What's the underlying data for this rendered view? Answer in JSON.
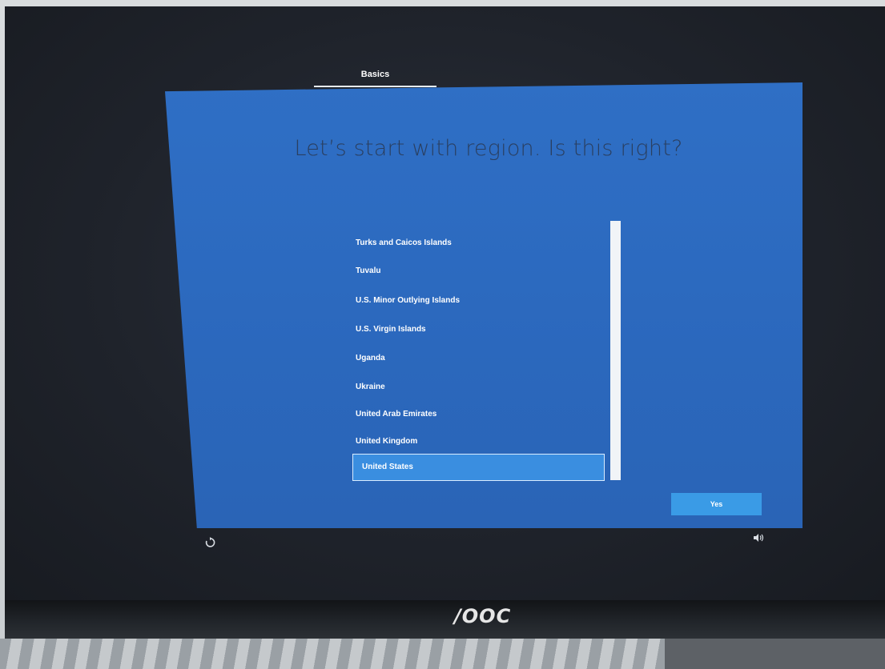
{
  "header": {
    "tab_label": "Basics"
  },
  "main": {
    "title": "Let’s start with region. Is this right?",
    "regions": [
      {
        "label": "Turks and Caicos Islands",
        "selected": false
      },
      {
        "label": "Tuvalu",
        "selected": false
      },
      {
        "label": "U.S. Minor Outlying Islands",
        "selected": false
      },
      {
        "label": "U.S. Virgin Islands",
        "selected": false
      },
      {
        "label": "Uganda",
        "selected": false
      },
      {
        "label": "Ukraine",
        "selected": false
      },
      {
        "label": "United Arab Emirates",
        "selected": false
      },
      {
        "label": "United Kingdom",
        "selected": false
      },
      {
        "label": "United States",
        "selected": true
      }
    ],
    "confirm_label": "Yes"
  },
  "footer": {
    "left_icon": "accessibility-icon",
    "right_icon": "volume-icon"
  },
  "monitor": {
    "brand": "/ΟOC"
  },
  "colors": {
    "panel_blue": "#2f6fc5",
    "selected_blue": "#3a8ee0",
    "button_blue": "#3a9be6"
  }
}
